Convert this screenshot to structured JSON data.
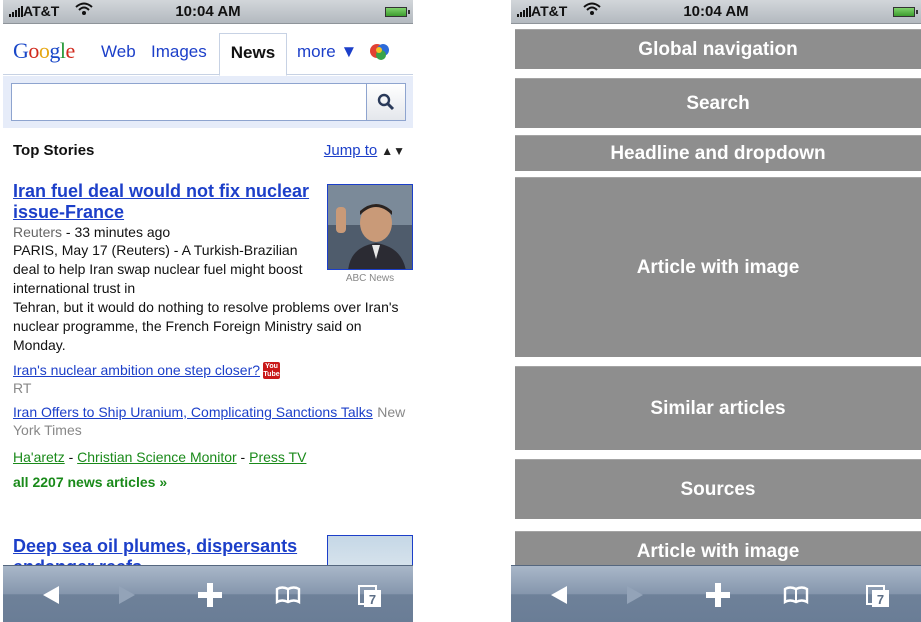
{
  "status_bar": {
    "carrier": "AT&T",
    "time": "10:04 AM"
  },
  "google": {
    "logo": {
      "parts": [
        "G",
        "o",
        "o",
        "g",
        "l",
        "e"
      ]
    },
    "tabs": {
      "web": "Web",
      "images": "Images",
      "news": "News",
      "more": "more ▼"
    },
    "search": {
      "value": "",
      "placeholder": ""
    }
  },
  "headline": {
    "top_stories": "Top Stories",
    "jump_to": "Jump to",
    "jump_arrow": "▲▼"
  },
  "article1": {
    "title": "Iran fuel deal would not fix nuclear issue-France",
    "source": "Reuters",
    "time": " - 33 minutes ago",
    "body_narrow": "PARIS, May 17 (Reuters) - A Turkish-Brazilian deal to help Iran swap nuclear fuel might boost international trust in",
    "body_full": "Tehran, but it would do nothing to resolve problems over Iran's nuclear programme, the French Foreign Ministry said on Monday.",
    "image_caption": "ABC News",
    "related": [
      {
        "link": "Iran's nuclear ambition one step closer?",
        "source": "RT",
        "icon": "youtube-icon"
      },
      {
        "link": "Iran Offers to Ship Uranium, Complicating Sanctions Talks",
        "source": "New York Times"
      }
    ],
    "sources": [
      "Ha'aretz",
      "Christian Science Monitor",
      "Press TV"
    ],
    "all_news": "all 2207 news articles »"
  },
  "article2": {
    "title": "Deep sea oil plumes, dispersants endanger reefs"
  },
  "youtube_text": {
    "top": "You",
    "bottom": "Tube"
  },
  "toolbar": {
    "tabs_count": "7",
    "icons": [
      "back-icon",
      "forward-icon",
      "add-icon",
      "bookmarks-icon",
      "tabs-icon"
    ]
  },
  "wireframe": {
    "blocks": [
      "Global navigation",
      "Search",
      "Headline and dropdown",
      "Article with image",
      "Similar articles",
      "Sources",
      "Article with image"
    ]
  },
  "colors": {
    "link": "#1c3fc9",
    "green": "#1a8a1a",
    "wire_gray": "#8e8e8e"
  }
}
